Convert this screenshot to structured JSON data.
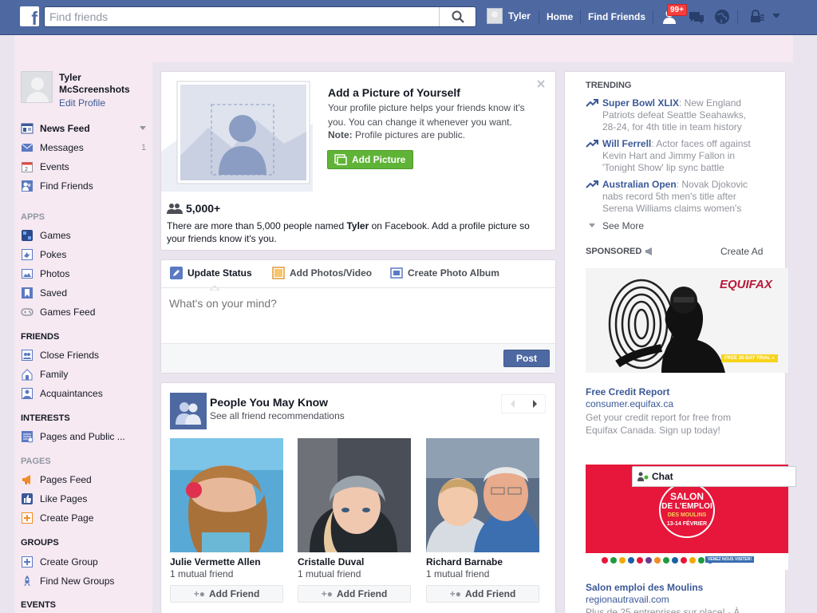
{
  "topbar": {
    "search_placeholder": "Find friends",
    "user": "Tyler",
    "home": "Home",
    "find_friends": "Find Friends",
    "badge": "99+"
  },
  "colors": {
    "brand": "#4e69a2",
    "link": "#3b5998",
    "green": "#5fb336",
    "badge": "#fa3e3e"
  },
  "profile": {
    "name": "Tyler McScreenshots",
    "edit": "Edit Profile"
  },
  "nav": {
    "main": [
      {
        "label": "News Feed",
        "icon": "news-feed-icon"
      },
      {
        "label": "Messages",
        "icon": "messages-icon",
        "count": "1"
      },
      {
        "label": "Events",
        "icon": "events-icon"
      },
      {
        "label": "Find Friends",
        "icon": "find-friends-icon"
      }
    ],
    "apps_title": "APPS",
    "apps": [
      {
        "label": "Games"
      },
      {
        "label": "Pokes"
      },
      {
        "label": "Photos"
      },
      {
        "label": "Saved"
      },
      {
        "label": "Games Feed"
      }
    ],
    "friends_title": "FRIENDS",
    "friends": [
      {
        "label": "Close Friends"
      },
      {
        "label": "Family"
      },
      {
        "label": "Acquaintances"
      }
    ],
    "interests_title": "INTERESTS",
    "interests": [
      {
        "label": "Pages and Public ..."
      }
    ],
    "pages_title": "PAGES",
    "pages": [
      {
        "label": "Pages Feed"
      },
      {
        "label": "Like Pages"
      },
      {
        "label": "Create Page"
      }
    ],
    "groups_title": "GROUPS",
    "groups": [
      {
        "label": "Create Group"
      },
      {
        "label": "Find New Groups"
      }
    ],
    "events_title": "EVENTS"
  },
  "add_picture": {
    "title": "Add a Picture of Yourself",
    "body": "Your profile picture helps your friends know it's you. You can change it whenever you want.",
    "note_label": "Note:",
    "note_text": " Profile pictures are public.",
    "button": "Add Picture",
    "count": "5,000+",
    "desc_pre": "There are more than 5,000 people named ",
    "desc_name": "Tyler",
    "desc_post": " on Facebook. Add a profile picture so your friends know it's you."
  },
  "composer": {
    "tab1": "Update Status",
    "tab2": "Add Photos/Video",
    "tab3": "Create Photo Album",
    "placeholder": "What's on your mind?",
    "post": "Post"
  },
  "pymk": {
    "title": "People You May Know",
    "subtitle": "See all friend recommendations",
    "add_label": "Add Friend",
    "people": [
      {
        "name": "Julie Vermette Allen",
        "mutual": "1 mutual friend"
      },
      {
        "name": "Cristalle Duval",
        "mutual": "1 mutual friend"
      },
      {
        "name": "Richard Barnabe",
        "mutual": "1 mutual friend"
      }
    ]
  },
  "trending": {
    "title": "TRENDING",
    "items": [
      {
        "topic": "Super Bowl XLIX",
        "text": ": New England Patriots defeat Seattle Seahawks, 28-24, for 4th title in team history"
      },
      {
        "topic": "Will Ferrell",
        "text": ": Actor faces off against Kevin Hart and Jimmy Fallon in 'Tonight Show' lip sync battle"
      },
      {
        "topic": "Australian Open",
        "text": ": Novak Djokovic nabs record 5th men's title after Serena Williams claims women's"
      }
    ],
    "see_more": "See More"
  },
  "sponsored": {
    "title": "SPONSORED",
    "create_ad": "Create Ad",
    "ad1": {
      "brand": "EQUIFAX",
      "trial": "FREE 30-DAY TRIAL »",
      "title": "Free Credit Report",
      "url": "consumer.equifax.ca",
      "desc": "Get your credit report for free from Equifax Canada. Sign up today!"
    },
    "ad2": {
      "line1": "SALON",
      "line2": "DE L'EMPLOI",
      "line3": "DES MOULINS",
      "line4": "13-14 FÉVRIER",
      "cta": "VENEZ NOUS VISITER!",
      "title": "Salon emploi des Moulins",
      "url": "regionautravail.com",
      "desc": "Plus de 25 entreprises sur place! - À"
    }
  },
  "chat": {
    "label": "Chat"
  }
}
